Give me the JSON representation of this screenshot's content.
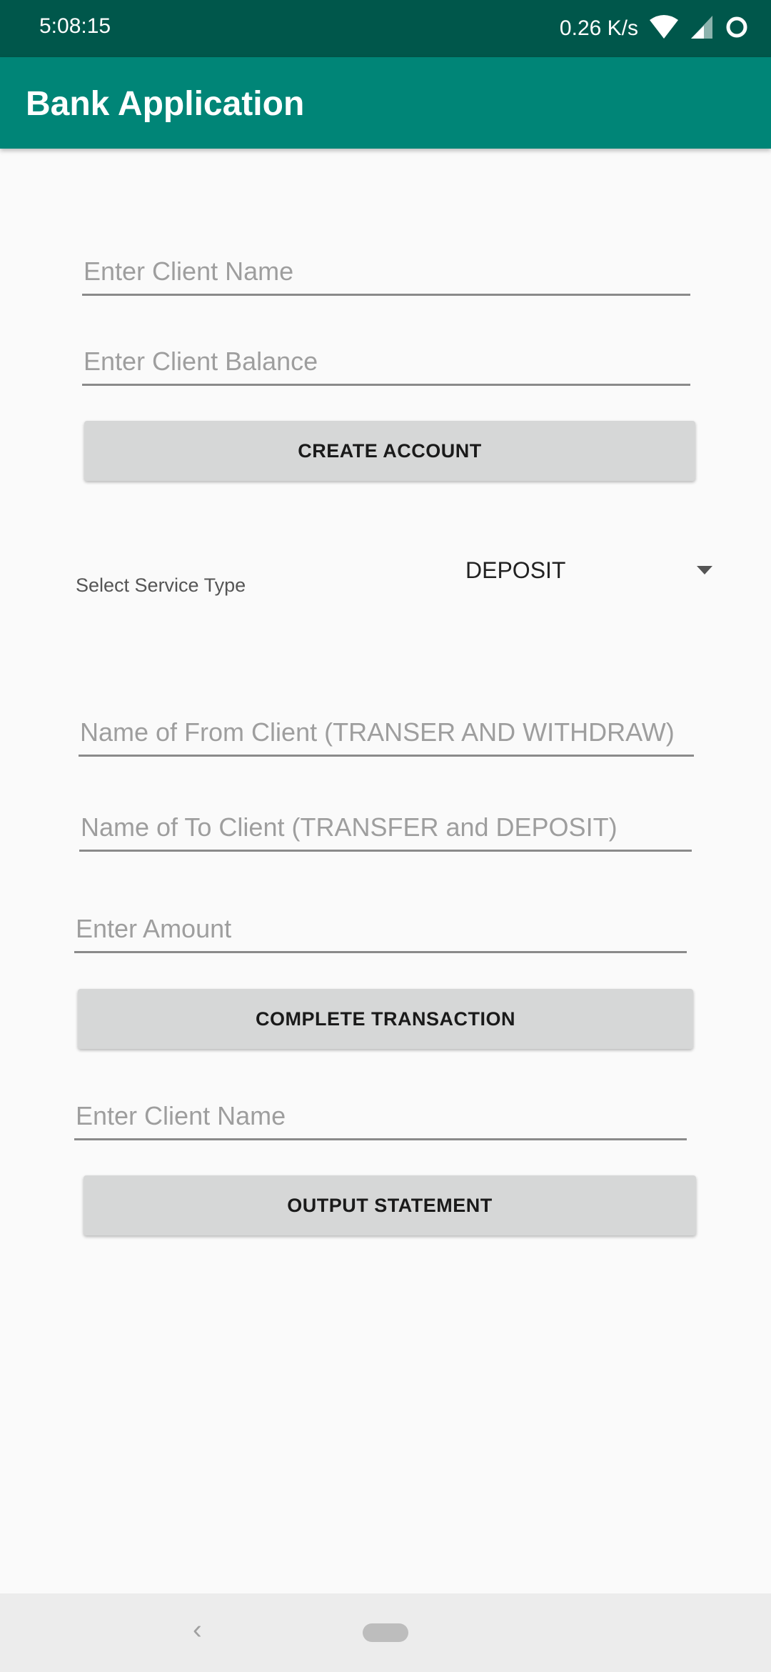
{
  "status_bar": {
    "time": "5:08:15",
    "net_speed": "0.26 K/s",
    "icons": [
      "wifi-icon",
      "cellular-signal-icon",
      "loading-circle-icon"
    ]
  },
  "app_bar": {
    "title": "Bank Application"
  },
  "account": {
    "client_name_placeholder": "Enter Client Name",
    "client_balance_placeholder": "Enter Client Balance",
    "create_button": "CREATE ACCOUNT"
  },
  "service": {
    "label": "Select Service Type",
    "selected": "DEPOSIT"
  },
  "transaction": {
    "from_client_placeholder": "Name of From Client (TRANSER AND WITHDRAW)",
    "to_client_placeholder": "Name of To Client (TRANSFER and DEPOSIT)",
    "amount_placeholder": "Enter Amount",
    "complete_button": "COMPLETE TRANSACTION"
  },
  "statement": {
    "client_name_placeholder": "Enter Client Name",
    "output_button": "OUTPUT STATEMENT"
  },
  "nav_bar": {
    "back_glyph": "‹"
  },
  "colors": {
    "status_bar": "#00574b",
    "app_bar": "#008577",
    "button": "#d6d7d7",
    "background": "#fafafa"
  }
}
